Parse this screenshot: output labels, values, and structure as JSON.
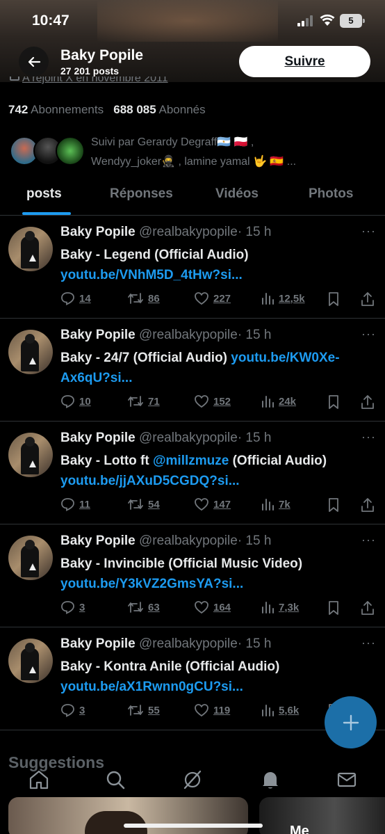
{
  "status_bar": {
    "time": "10:47",
    "battery": "5"
  },
  "header": {
    "name": "Baky Popile",
    "posts_count": "27 201 posts",
    "follow_label": "Suivre"
  },
  "profile": {
    "joined": "A rejoint X en novembre 2011",
    "following_count": "742",
    "following_label": "Abonnements",
    "followers_count": "688 085",
    "followers_label": "Abonnés",
    "followed_by_line1": "Suivi par Gerardy Degraff🇦🇷 🇵🇱 ,",
    "followed_by_line2": "Wendyy_joker🥷 , lamine yamal 🤟 🇪🇸 ..."
  },
  "tabs": [
    {
      "label": "posts"
    },
    {
      "label": "Réponses"
    },
    {
      "label": "Vidéos"
    },
    {
      "label": "Photos"
    }
  ],
  "posts": [
    {
      "name": "Baky Popile",
      "handle": "@realbakypopile",
      "time": "· 15 h",
      "text": "Baky - Legend (Official Audio) ",
      "mention": "",
      "text_after": "",
      "link": "youtu.be/VNhM5D_4tHw?si...",
      "replies": "14",
      "reposts": "86",
      "likes": "227",
      "views": "12,5k"
    },
    {
      "name": "Baky Popile",
      "handle": "@realbakypopile",
      "time": "· 15 h",
      "text": "Baky - 24/7 (Official Audio) ",
      "mention": "",
      "text_after": "",
      "link": "youtu.be/KW0Xe-Ax6qU?si...",
      "replies": "10",
      "reposts": "71",
      "likes": "152",
      "views": "24k"
    },
    {
      "name": "Baky Popile",
      "handle": "@realbakypopile",
      "time": "· 15 h",
      "text": "Baky - Lotto ft ",
      "mention": "@millzmuze",
      "text_after": " (Official Audio) ",
      "link": "youtu.be/jjAXuD5CGDQ?si...",
      "replies": "11",
      "reposts": "54",
      "likes": "147",
      "views": "7k"
    },
    {
      "name": "Baky Popile",
      "handle": "@realbakypopile",
      "time": "· 15 h",
      "text": "Baky - Invincible (Official Music Video) ",
      "mention": "",
      "text_after": "",
      "link": "youtu.be/Y3kVZ2GmsYA?si...",
      "replies": "3",
      "reposts": "63",
      "likes": "164",
      "views": "7,3k"
    },
    {
      "name": "Baky Popile",
      "handle": "@realbakypopile",
      "time": "· 15 h",
      "text": "Baky - Kontra Anile (Official Audio) ",
      "mention": "",
      "text_after": "",
      "link": "youtu.be/aX1Rwnn0gCU?si...",
      "replies": "3",
      "reposts": "55",
      "likes": "119",
      "views": "5,6k"
    }
  ],
  "suggestions_title": "Suggestions",
  "suggestion_card_badge": "Me",
  "nav_icons": [
    "home-icon",
    "search-icon",
    "grok-icon",
    "notifications-icon",
    "messages-icon"
  ],
  "colors": {
    "accent": "#1d9bf0",
    "background": "#000000",
    "muted": "#71767b",
    "text": "#e7e9ea"
  }
}
